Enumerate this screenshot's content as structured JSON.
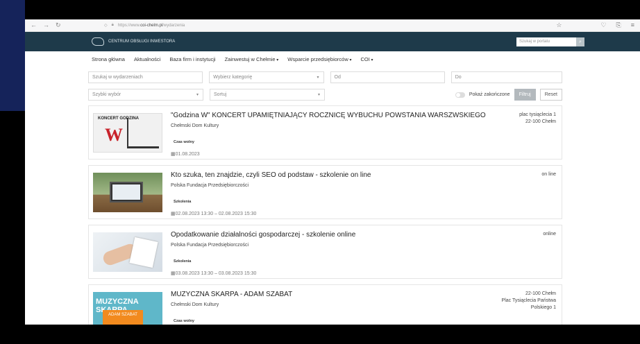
{
  "browser": {
    "url_prefix": "https://www.",
    "url_domain": "coi-chelm.pl",
    "url_path": "/wydarzenia"
  },
  "header": {
    "logo_title": "CENTRUM OBSŁUGI INWESTORA",
    "search_placeholder": "Szukaj w portalu"
  },
  "menu": {
    "items": [
      {
        "label": "Strona główna",
        "dropdown": false
      },
      {
        "label": "Aktualności",
        "dropdown": false
      },
      {
        "label": "Baza firm i instytucji",
        "dropdown": false
      },
      {
        "label": "Zainwestuj w Chełmie",
        "dropdown": true
      },
      {
        "label": "Wsparcie przedsiębiorców",
        "dropdown": true
      },
      {
        "label": "COI",
        "dropdown": true
      }
    ]
  },
  "filters": {
    "search_placeholder": "Szukaj w wydarzeniach",
    "category_placeholder": "Wybierz kategorię",
    "from_placeholder": "Od",
    "to_placeholder": "Do",
    "quick_placeholder": "Szybki wybór",
    "sort_placeholder": "Sortuj",
    "show_finished_label": "Pokaż zakończone",
    "filter_button": "Filtruj",
    "reset_button": "Reset"
  },
  "events": [
    {
      "title": "\"Godzina W\" KONCERT UPAMIĘTNIAJĄCY ROCZNICĘ WYBUCHU POWSTANIA WARSZWSKIEGO",
      "organizer": "Chełmski Dom Kultury",
      "tag": "Czas wolny",
      "date": "01.08.2023",
      "location": "plac tysiąclecia 1\n22-100 Chełm",
      "thumb_text": "KONCERT GODZINA"
    },
    {
      "title": "Kto szuka, ten znajdzie, czyli SEO od podstaw - szkolenie on line",
      "organizer": "Polska Fundacja Przedsiębiorczości",
      "tag": "Szkolenia",
      "date": "02.08.2023 13:30 – 02.08.2023 15:30",
      "location": "on line"
    },
    {
      "title": "Opodatkowanie działalności gospodarczej - szkolenie online",
      "organizer": "Polska Fundacja Przedsiębiorczości",
      "tag": "Szkolenia",
      "date": "03.08.2023 13:30 – 03.08.2023 15:30",
      "location": "online"
    },
    {
      "title": "MUZYCZNA SKARPA - ADAM SZABAT",
      "organizer": "Chełmski Dom Kultury",
      "tag": "Czas wolny",
      "date": "",
      "location": "22-100 Chełm\nPlac Tysiąclecia Państwa\nPolskiego 1",
      "thumb_text": "MUZYCZNA SKARPA",
      "thumb_sub": "ADAM SZABAT"
    }
  ]
}
